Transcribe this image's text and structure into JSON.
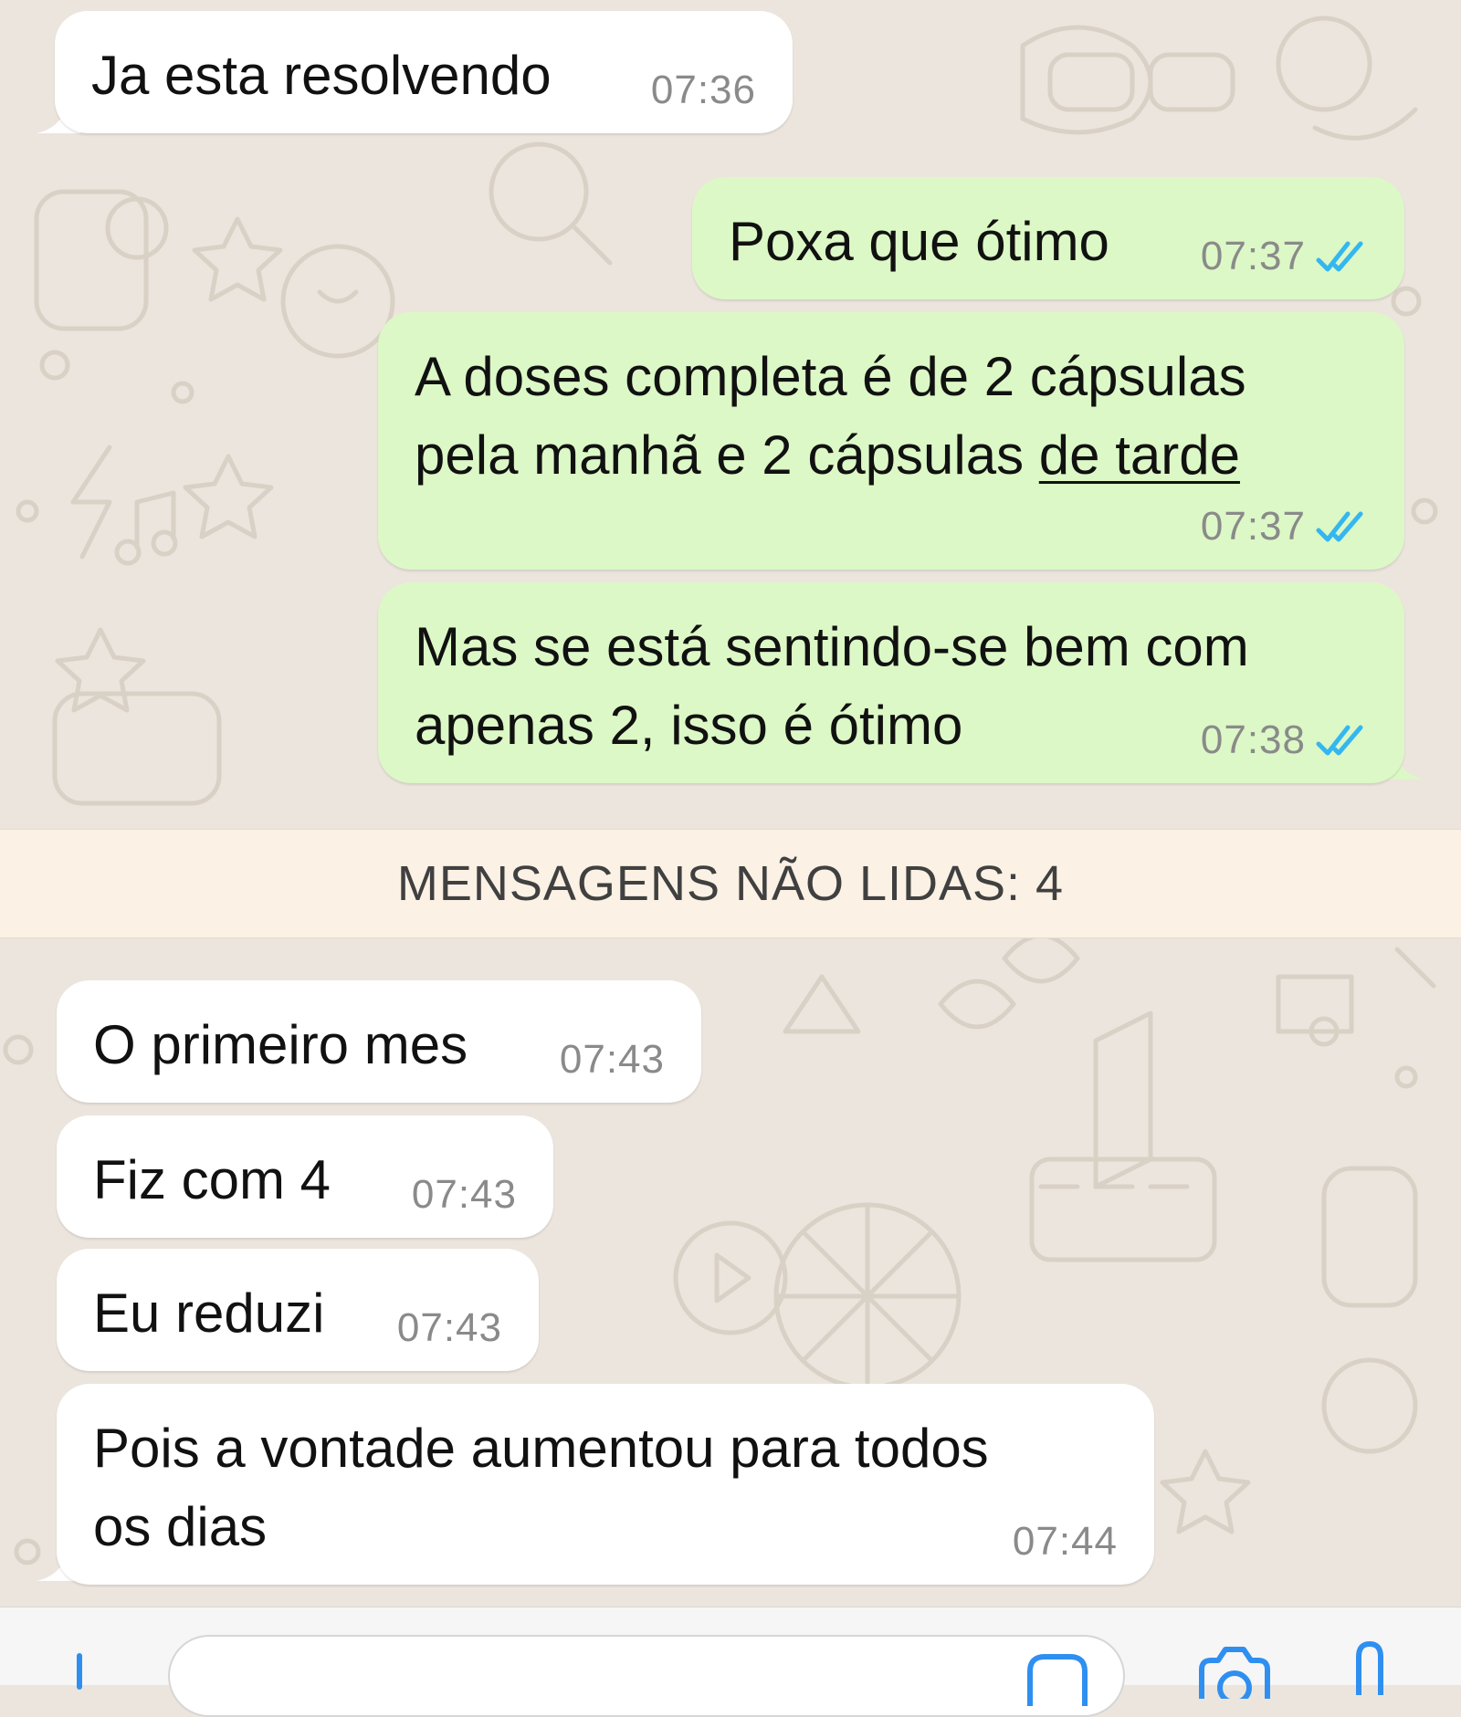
{
  "conversation": {
    "messages": [
      {
        "text": "Ja esta resolvendo",
        "time": "07:36"
      },
      {
        "text": "Poxa que ótimo",
        "time": "07:37"
      },
      {
        "line1": "A doses completa é de 2 cápsulas",
        "line2a": "pela manhã e 2 cápsulas ",
        "line2b": "de tarde",
        "time": "07:37"
      },
      {
        "line1": "Mas se está sentindo-se bem com",
        "line2": "apenas 2, isso é ótimo",
        "time": "07:38"
      },
      {
        "text": "O primeiro mes",
        "time": "07:43"
      },
      {
        "text": "Fiz com 4",
        "time": "07:43"
      },
      {
        "text": "Eu reduzi",
        "time": "07:43"
      },
      {
        "line1": "Pois a vontade aumentou para todos",
        "line2": "os dias",
        "time": "07:44"
      }
    ],
    "unread_label": "MENSAGENS NÃO LIDAS: 4"
  },
  "colors": {
    "background": "#ece5dd",
    "incoming_bubble": "#ffffff",
    "outgoing_bubble": "#dcf8c6",
    "read_ticks": "#34b7f1",
    "unread_bar": "#fbf1e4",
    "accent": "#2f8ff0"
  },
  "icons": {
    "read_status": "double-check-icon",
    "composer": [
      "plus-icon",
      "sticker-icon",
      "camera-icon",
      "microphone-icon"
    ]
  }
}
